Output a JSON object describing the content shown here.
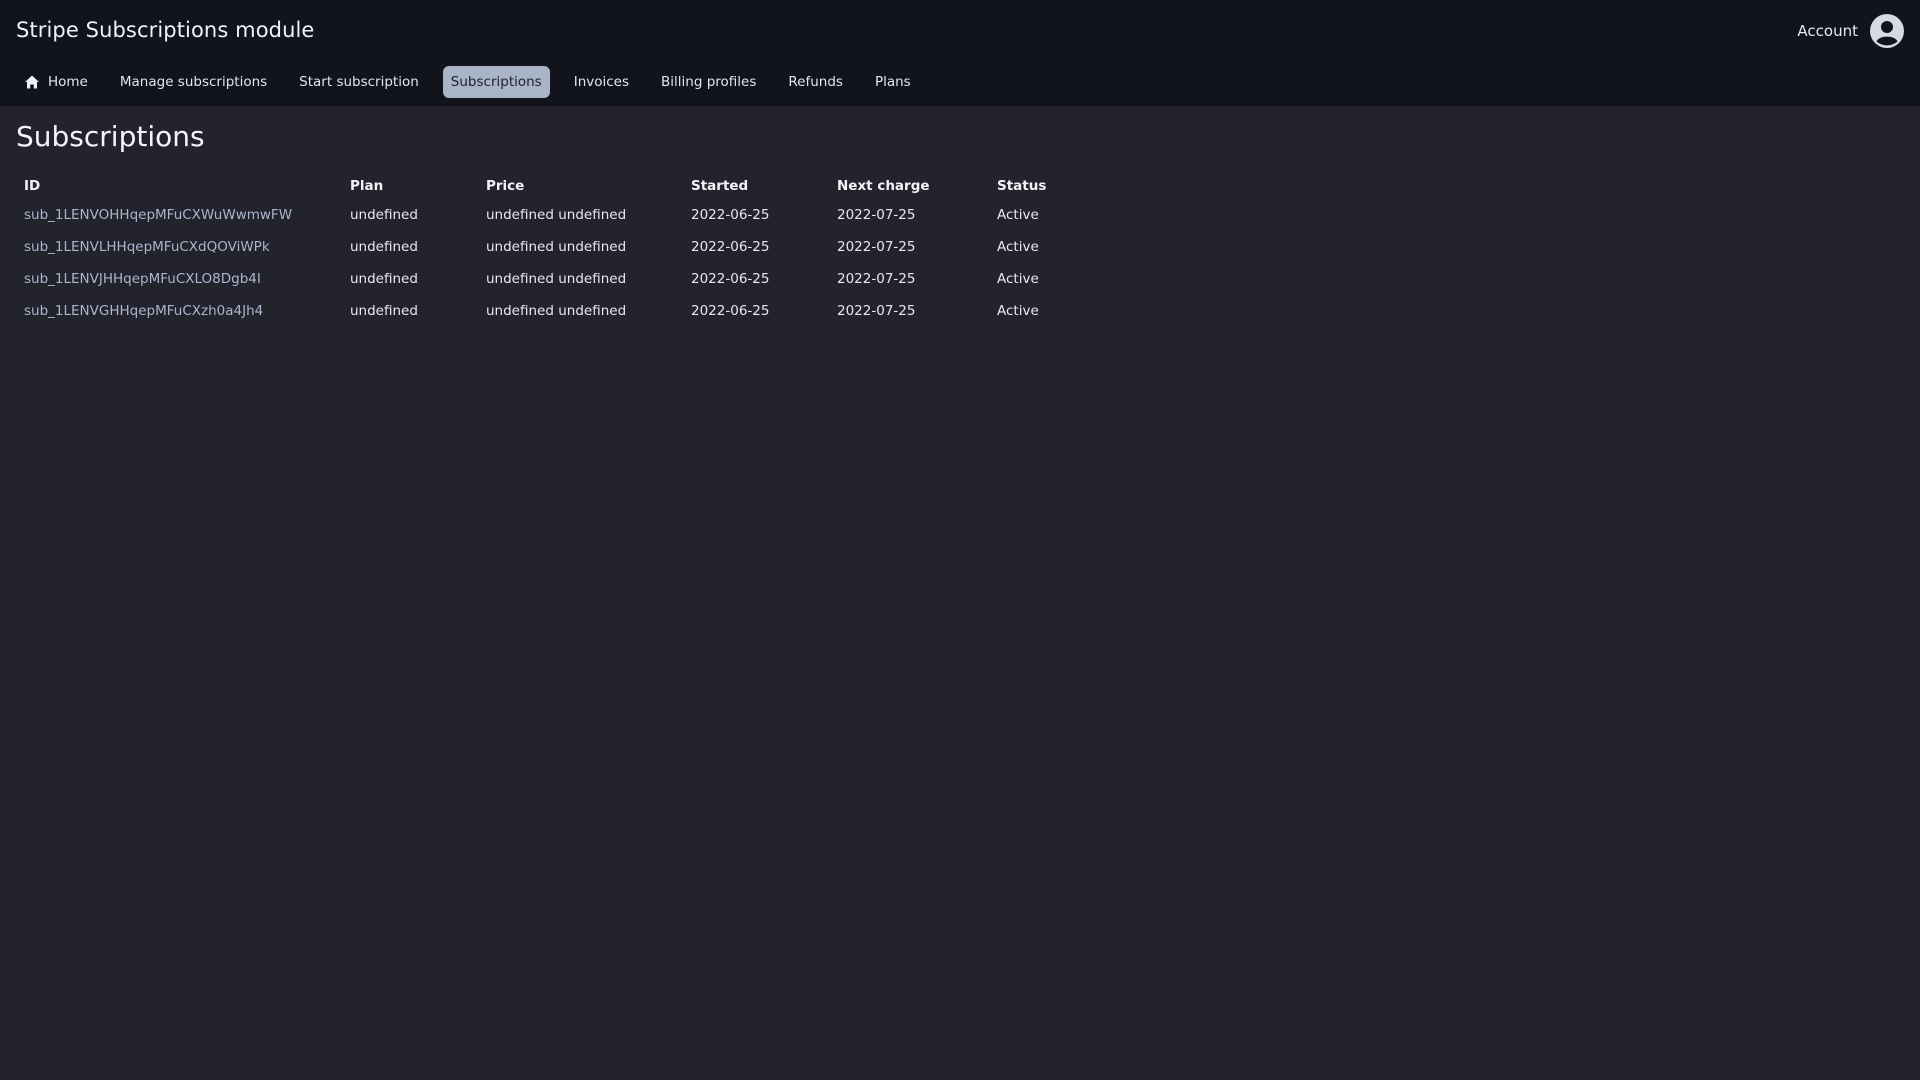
{
  "header": {
    "title": "Stripe Subscriptions module",
    "account_label": "Account"
  },
  "nav": {
    "items": [
      {
        "label": "Home",
        "icon": "home-icon",
        "active": false
      },
      {
        "label": "Manage subscriptions",
        "active": false
      },
      {
        "label": "Start subscription",
        "active": false
      },
      {
        "label": "Subscriptions",
        "active": true
      },
      {
        "label": "Invoices",
        "active": false
      },
      {
        "label": "Billing profiles",
        "active": false
      },
      {
        "label": "Refunds",
        "active": false
      },
      {
        "label": "Plans",
        "active": false
      }
    ]
  },
  "main": {
    "title": "Subscriptions",
    "table": {
      "columns": [
        "ID",
        "Plan",
        "Price",
        "Started",
        "Next charge",
        "Status"
      ],
      "rows": [
        {
          "id": "sub_1LENVOHHqepMFuCXWuWwmwFW",
          "plan": "undefined",
          "price": "undefined undefined",
          "started": "2022-06-25",
          "next_charge": "2022-07-25",
          "status": "Active"
        },
        {
          "id": "sub_1LENVLHHqepMFuCXdQOViWPk",
          "plan": "undefined",
          "price": "undefined undefined",
          "started": "2022-06-25",
          "next_charge": "2022-07-25",
          "status": "Active"
        },
        {
          "id": "sub_1LENVJHHqepMFuCXLO8Dgb4I",
          "plan": "undefined",
          "price": "undefined undefined",
          "started": "2022-06-25",
          "next_charge": "2022-07-25",
          "status": "Active"
        },
        {
          "id": "sub_1LENVGHHqepMFuCXzh0a4Jh4",
          "plan": "undefined",
          "price": "undefined undefined",
          "started": "2022-06-25",
          "next_charge": "2022-07-25",
          "status": "Active"
        }
      ]
    }
  },
  "colors": {
    "header_bg": "#11131d",
    "page_bg": "#22232d",
    "active_nav_bg": "#a9b4c6",
    "link": "#aab6cc"
  }
}
